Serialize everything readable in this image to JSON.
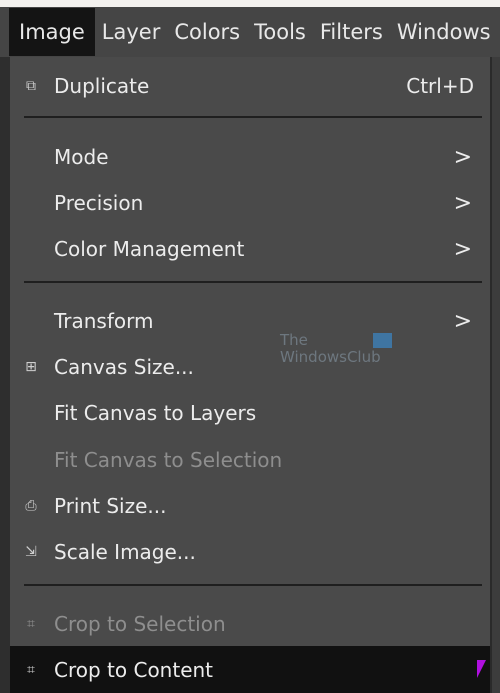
{
  "menubar": {
    "items": [
      "Image",
      "Layer",
      "Colors",
      "Tools",
      "Filters",
      "Windows"
    ],
    "active": "Image"
  },
  "menu": {
    "duplicate": {
      "label": "Duplicate",
      "shortcut": "Ctrl+D",
      "icon": "duplicate-icon"
    },
    "mode": {
      "label": "Mode",
      "submenu": ">"
    },
    "precision": {
      "label": "Precision",
      "submenu": ">"
    },
    "color_management": {
      "label": "Color Management",
      "submenu": ">"
    },
    "transform": {
      "label": "Transform",
      "submenu": ">"
    },
    "canvas_size": {
      "label": "Canvas Size...",
      "icon": "canvas-size-icon"
    },
    "fit_layers": {
      "label": "Fit Canvas to Layers"
    },
    "fit_selection": {
      "label": "Fit Canvas to Selection",
      "disabled": true
    },
    "print_size": {
      "label": "Print Size...",
      "icon": "printer-icon"
    },
    "scale_image": {
      "label": "Scale Image...",
      "icon": "scale-icon"
    },
    "crop_selection": {
      "label": "Crop to Selection",
      "disabled": true,
      "icon": "crop-icon"
    },
    "crop_content": {
      "label": "Crop to Content",
      "highlighted": true,
      "icon": "crop-icon"
    }
  },
  "watermark": {
    "line1": "The",
    "line2": "WindowsClub"
  },
  "colors": {
    "menu_bg": "#4a4a4a",
    "highlight": "#111111",
    "cursor": "#b010e0"
  }
}
